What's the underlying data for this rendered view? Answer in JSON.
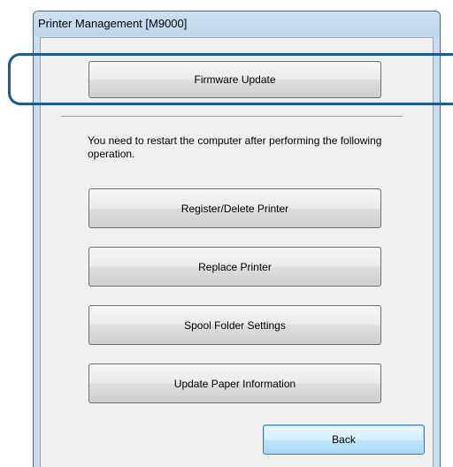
{
  "window": {
    "title": "Printer Management [M9000]"
  },
  "buttons": {
    "firmware_update": "Firmware Update",
    "register_delete_printer": "Register/Delete Printer",
    "replace_printer": "Replace Printer",
    "spool_folder_settings": "Spool Folder Settings",
    "update_paper_information": "Update Paper Information",
    "back": "Back"
  },
  "message": "You need to restart the computer after performing the following operation."
}
